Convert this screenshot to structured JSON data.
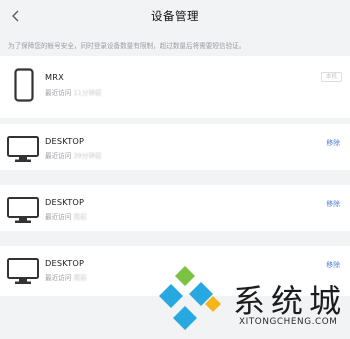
{
  "header": {
    "title": "设备管理"
  },
  "notice": "为了保障您的帐号安全，同时登录设备数量有限制，超过数量后将需要短信验证。",
  "devices": [
    {
      "name": "MRX",
      "last_visit": "最近访问 ",
      "last_visit_blur": "11分钟前",
      "sub_blur": "",
      "badge": "本机",
      "icon": "phone-icon"
    },
    {
      "name": "DESKTOP",
      "last_visit": "最近访问 ",
      "last_visit_blur": "39分钟前",
      "sub_blur": "",
      "action": "移除",
      "icon": "monitor-icon"
    },
    {
      "name": "DESKTOP",
      "last_visit": "最近访问 ",
      "last_visit_blur": "周前",
      "sub_blur": "",
      "action": "移除",
      "icon": "monitor-icon"
    },
    {
      "name": "DESKTOP",
      "last_visit": "最近访问 ",
      "last_visit_blur": "周前",
      "sub_blur": "",
      "action": "移除",
      "icon": "monitor-icon"
    }
  ],
  "watermark": {
    "text": "系统城",
    "url": "XITONGCHENG.COM"
  },
  "colors": {
    "link": "#4b7ed9",
    "background": "#f2f3f5",
    "card": "#ffffff"
  }
}
